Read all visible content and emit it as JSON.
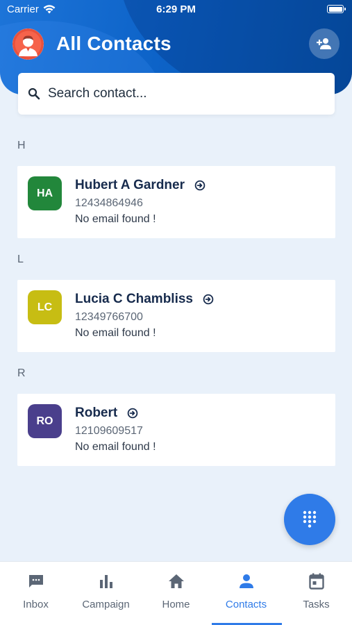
{
  "status_bar": {
    "carrier": "Carrier",
    "time": "6:29 PM"
  },
  "header": {
    "title": "All Contacts",
    "avatar_icon": "user-avatar",
    "add_contact_icon": "person-add-icon"
  },
  "search": {
    "placeholder": "Search contact..."
  },
  "sections": [
    {
      "letter": "H",
      "contact": {
        "initials": "HA",
        "name": "Hubert A Gardner",
        "phone": "12434864946",
        "email": "No email found !",
        "color": "#22873b"
      }
    },
    {
      "letter": "L",
      "contact": {
        "initials": "LC",
        "name": "Lucia C Chambliss",
        "phone": "12349766700",
        "email": "No email found !",
        "color": "#c7bd13"
      }
    },
    {
      "letter": "R",
      "contact": {
        "initials": "RO",
        "name": "Robert",
        "phone": "12109609517",
        "email": "No email found !",
        "color": "#4a3f8c"
      }
    }
  ],
  "fab": {
    "icon": "dialpad-icon"
  },
  "tabs": [
    {
      "label": "Inbox",
      "icon": "chat-icon",
      "active": false
    },
    {
      "label": "Campaign",
      "icon": "bar-chart-icon",
      "active": false
    },
    {
      "label": "Home",
      "icon": "home-icon",
      "active": false
    },
    {
      "label": "Contacts",
      "icon": "person-icon",
      "active": true
    },
    {
      "label": "Tasks",
      "icon": "calendar-icon",
      "active": false
    }
  ],
  "colors": {
    "accent": "#2f7be8",
    "header": "#0d63c8",
    "background": "#e9f1fa"
  }
}
